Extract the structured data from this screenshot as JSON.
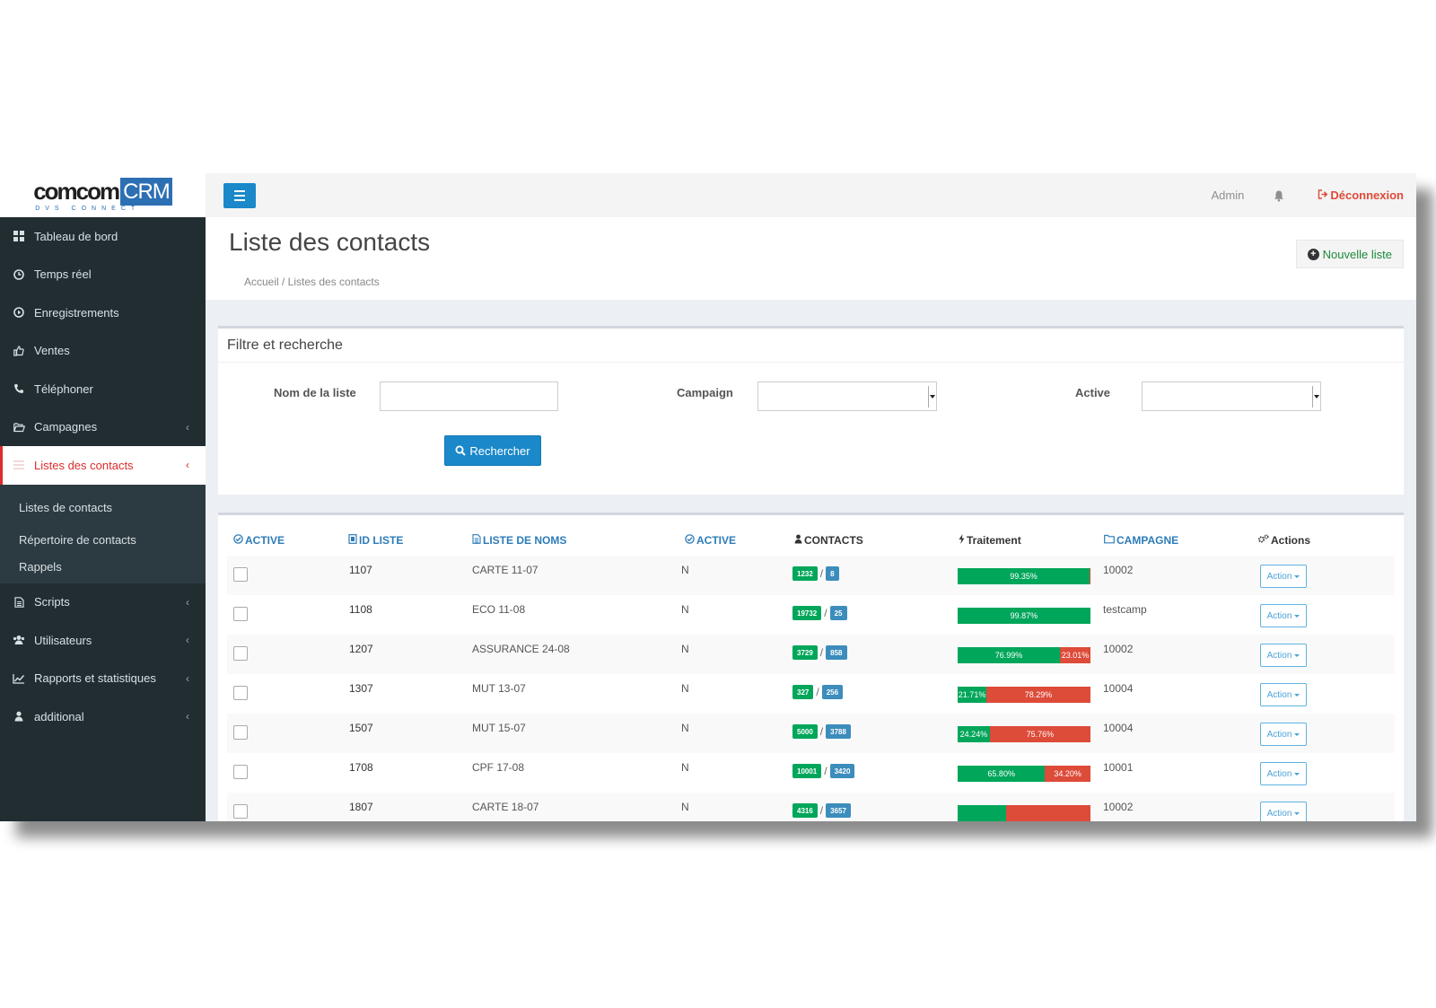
{
  "brand": {
    "name": "comcom",
    "suffix": "CRM",
    "subtitle": "DVS CONNECT"
  },
  "colors": {
    "sidebar_bg": "#222d32",
    "accent_blue": "#1a88c9",
    "active_red": "#dd2c2c",
    "success_green": "#00a65a",
    "danger_red": "#dd4b39"
  },
  "sidebar": {
    "items": [
      {
        "label": "Tableau de bord",
        "icon": "dashboard-icon"
      },
      {
        "label": "Temps réel",
        "icon": "clock-icon"
      },
      {
        "label": "Enregistrements",
        "icon": "play-circle-icon"
      },
      {
        "label": "Ventes",
        "icon": "thumbs-up-icon"
      },
      {
        "label": "Téléphoner",
        "icon": "phone-icon"
      },
      {
        "label": "Campagnes",
        "icon": "folder-open-icon"
      },
      {
        "label": "Listes des contacts",
        "icon": "list-icon"
      }
    ],
    "submenu": [
      "Listes de contacts",
      "Répertoire de contacts",
      "Rappels"
    ],
    "items_after": [
      {
        "label": "Scripts",
        "icon": "file-text-icon"
      },
      {
        "label": "Utilisateurs",
        "icon": "users-icon"
      },
      {
        "label": "Rapports et statistiques",
        "icon": "line-chart-icon"
      },
      {
        "label": "additional",
        "icon": "user-icon"
      }
    ]
  },
  "header": {
    "user": "Admin",
    "logout": "Déconnexion"
  },
  "page": {
    "title": "Liste des contacts",
    "breadcrumb": "Accueil / Listes des contacts",
    "new_button": "Nouvelle liste"
  },
  "filter": {
    "title": "Filtre et recherche",
    "name_label": "Nom de la liste",
    "name_value": "",
    "campaign_label": "Campaign",
    "campaign_value": "",
    "active_label": "Active",
    "active_value": "",
    "search_button": "Rechercher"
  },
  "table": {
    "headers": [
      "ACTIVE",
      "ID LISTE",
      "LISTE DE NOMS",
      "ACTIVE",
      "CONTACTS",
      "Traitement",
      "CAMPAGNE",
      "Actions"
    ],
    "action_label": "Action",
    "rows": [
      {
        "id": "1107",
        "name": "CARTE 11-07",
        "active": "N",
        "contacts_a": "1232",
        "contacts_b": "8",
        "green_pct": 99.35,
        "green_label": "99.35%",
        "red_label": "",
        "campaign": "10002"
      },
      {
        "id": "1108",
        "name": "ECO 11-08",
        "active": "N",
        "contacts_a": "19732",
        "contacts_b": "25",
        "green_pct": 99.87,
        "green_label": "99.87%",
        "red_label": "",
        "campaign": "testcamp"
      },
      {
        "id": "1207",
        "name": "ASSURANCE 24-08",
        "active": "N",
        "contacts_a": "3729",
        "contacts_b": "858",
        "green_pct": 76.99,
        "green_label": "76.99%",
        "red_label": "23.01%",
        "campaign": "10002"
      },
      {
        "id": "1307",
        "name": "MUT 13-07",
        "active": "N",
        "contacts_a": "327",
        "contacts_b": "256",
        "green_pct": 21.71,
        "green_label": "21.71%",
        "red_label": "78.29%",
        "campaign": "10004"
      },
      {
        "id": "1507",
        "name": "MUT 15-07",
        "active": "N",
        "contacts_a": "5000",
        "contacts_b": "3788",
        "green_pct": 24.24,
        "green_label": "24.24%",
        "red_label": "75.76%",
        "campaign": "10004"
      },
      {
        "id": "1708",
        "name": "CPF 17-08",
        "active": "N",
        "contacts_a": "10001",
        "contacts_b": "3420",
        "green_pct": 65.8,
        "green_label": "65.80%",
        "red_label": "34.20%",
        "campaign": "10001"
      },
      {
        "id": "1807",
        "name": "CARTE 18-07",
        "active": "N",
        "contacts_a": "4316",
        "contacts_b": "3657",
        "green_pct": 36.5,
        "green_label": "",
        "red_label": "",
        "campaign": "10002"
      }
    ]
  }
}
